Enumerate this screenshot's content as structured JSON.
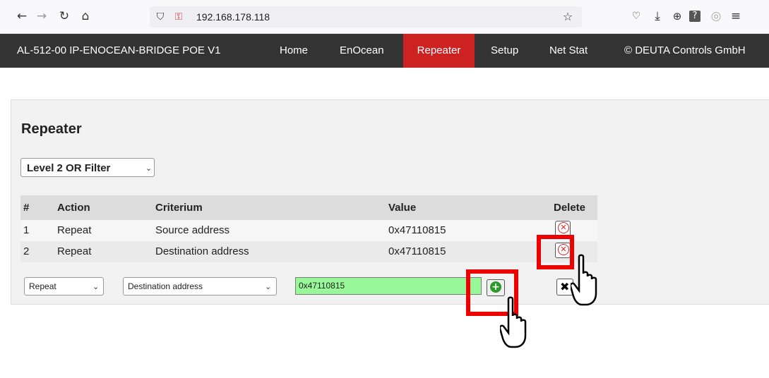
{
  "browser": {
    "url": "192.168.178.118",
    "icons": [
      "back-arrow-icon",
      "forward-arrow-icon",
      "reload-icon",
      "home-icon",
      "shield-icon",
      "insecure-lock-icon",
      "bookmark-star-icon",
      "pocket-icon",
      "download-icon",
      "zoom-icon",
      "help-icon",
      "account-icon",
      "menu-icon"
    ]
  },
  "nav": {
    "brand": "AL-512-00 IP-ENOCEAN-BRIDGE POE V1",
    "items": [
      "Home",
      "EnOcean",
      "Repeater",
      "Setup",
      "Net Stat"
    ],
    "active": "Repeater",
    "copyright": "© DEUTA Controls GmbH",
    "active_color": "#cc2222",
    "bar_color": "#333333"
  },
  "page": {
    "title": "Repeater",
    "filter_select": "Level 2 OR Filter"
  },
  "table": {
    "headers": [
      "#",
      "Action",
      "Criterium",
      "Value",
      "Delete"
    ],
    "rows": [
      {
        "num": "1",
        "action": "Repeat",
        "criterium": "Source address",
        "value": "0x47110815"
      },
      {
        "num": "2",
        "action": "Repeat",
        "criterium": "Destination address",
        "value": "0x47110815"
      }
    ]
  },
  "new_entry": {
    "action": "Repeat",
    "criterium": "Destination address",
    "value": "0x47110815",
    "value_bg": "#98f798"
  },
  "highlight_color": "#ee0000"
}
